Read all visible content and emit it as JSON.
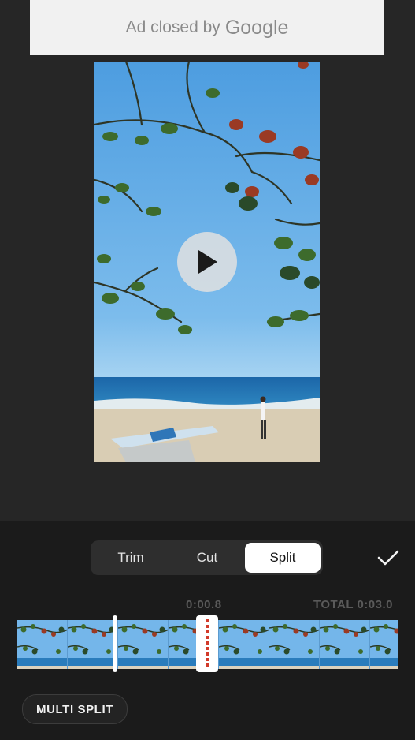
{
  "ad": {
    "text": "Ad closed by",
    "brand": "Google"
  },
  "video": {
    "play_icon": "play-icon"
  },
  "edit_modes": {
    "items": [
      {
        "label": "Trim",
        "active": false
      },
      {
        "label": "Cut",
        "active": false
      },
      {
        "label": "Split",
        "active": true
      }
    ],
    "confirm_icon": "checkmark-icon"
  },
  "timeline": {
    "current_time": "0:00.8",
    "total_time": "TOTAL 0:03.0"
  },
  "actions": {
    "multi_split_label": "MULTI SPLIT"
  },
  "colors": {
    "active_segment": "#ffffff",
    "playhead_marker": "#d23a2a",
    "panel_background": "#1b1b1b"
  }
}
